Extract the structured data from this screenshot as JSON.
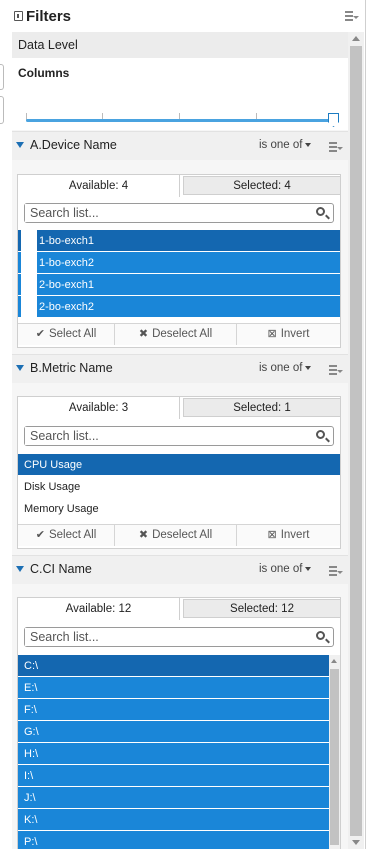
{
  "panel": {
    "title": "Filters",
    "data_level_label": "Data Level",
    "columns_label": "Columns"
  },
  "sections": [
    {
      "name": "A.Device Name",
      "operator": "is one of",
      "available_label": "Available: 4",
      "selected_label": "Selected: 4",
      "search_placeholder": "Search list...",
      "items": [
        "1-bo-exch1",
        "1-bo-exch2",
        "2-bo-exch1",
        "2-bo-exch2"
      ],
      "actions": {
        "select_all": "Select All",
        "deselect_all": "Deselect All",
        "invert": "Invert"
      }
    },
    {
      "name": "B.Metric Name",
      "operator": "is one of",
      "available_label": "Available: 3",
      "selected_label": "Selected: 1",
      "search_placeholder": "Search list...",
      "items": [
        "CPU Usage",
        "Disk Usage",
        "Memory Usage"
      ],
      "actions": {
        "select_all": "Select All",
        "deselect_all": "Deselect All",
        "invert": "Invert"
      }
    },
    {
      "name": "C.CI Name",
      "operator": "is one of",
      "available_label": "Available: 12",
      "selected_label": "Selected: 12",
      "search_placeholder": "Search list...",
      "items": [
        "C:\\",
        "E:\\",
        "F:\\",
        "G:\\",
        "H:\\",
        "I:\\",
        "J:\\",
        "K:\\",
        "P:\\"
      ]
    }
  ],
  "colors": {
    "selected_row": "#1a86d8",
    "focused_row": "#1467b0",
    "accent": "#1c6fb4"
  }
}
